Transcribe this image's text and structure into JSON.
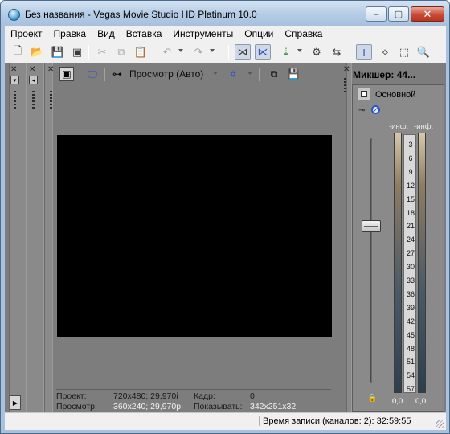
{
  "window": {
    "title": "Без названия - Vegas Movie Studio HD Platinum 10.0",
    "controls": {
      "minimize": "–",
      "maximize": "▢",
      "close": "✕"
    }
  },
  "menu": [
    "Проект",
    "Правка",
    "Вид",
    "Вставка",
    "Инструменты",
    "Опции",
    "Справка"
  ],
  "toolbar": {
    "icons": [
      "new-file-icon",
      "open-folder-icon",
      "save-icon",
      "render-icon",
      "cut-icon",
      "copy-icon",
      "paste-icon",
      "undo-icon",
      "redo-icon",
      "auto-ripple-icon",
      "crossfade-icon",
      "snap-icon",
      "lock-envelope-icon",
      "auto-crossfade-icon",
      "normal-edit-tool-icon",
      "envelope-tool-icon",
      "selection-tool-icon",
      "zoom-tool-icon"
    ]
  },
  "preview": {
    "mode_label": "Просмотр (Авто)",
    "info": {
      "project_label": "Проект:",
      "project_value": "720x480; 29,970i",
      "preview_label": "Просмотр:",
      "preview_value": "360x240; 29,970p",
      "frame_label": "Кадр:",
      "frame_value": "0",
      "display_label": "Показывать:",
      "display_value": "342x251x32"
    }
  },
  "mixer": {
    "title": "Микшер: 44...",
    "bus_name": "Основной",
    "peak_left": "-инф.",
    "peak_right": "-инф.",
    "scale": [
      "3",
      "6",
      "9",
      "12",
      "15",
      "18",
      "21",
      "24",
      "27",
      "30",
      "33",
      "36",
      "39",
      "42",
      "45",
      "48",
      "51",
      "54",
      "57"
    ],
    "meter_left_value": "0,0",
    "meter_right_value": "0,0"
  },
  "status": {
    "record_time": "Время записи (каналов: 2): 32:59:55"
  }
}
